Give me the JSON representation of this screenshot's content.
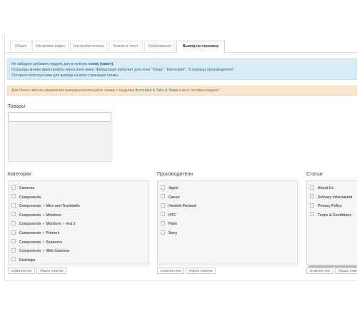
{
  "tabs": [
    {
      "label": "Общее"
    },
    {
      "label": "Настройки видео"
    },
    {
      "label": "Настройки показа"
    },
    {
      "label": "Кнопки и текст"
    },
    {
      "label": "Изображения"
    },
    {
      "label": "Вывод на странице"
    }
  ],
  "info_alert": {
    "line1_pre": "Не забудьте добавить модуль для в нужную ",
    "line1_bold": "схему (макет)",
    "line1_post": ".",
    "line2": "Страницы можно фильтровать через поля ниже. Фильтрация работает для схем \"Товар\", \"Категория\", \"Страница производителя\".",
    "line3": "Оставьте поля пустыми для вывода на всех страницах схемы."
  },
  "warning_alert": {
    "pre": "Для более гибкого управления выводом используйте связку с модулем ",
    "link": "Accordion & Tabs & Steps",
    "post": " и ф-ю \"вставка модуля\""
  },
  "products": {
    "title": "Товары",
    "value": ""
  },
  "categories": {
    "title": "Категории",
    "items": [
      [
        "Cameras"
      ],
      [
        "Components"
      ],
      [
        "Components",
        "Mice and Trackballs"
      ],
      [
        "Components",
        "Monitors"
      ],
      [
        "Components",
        "Monitors",
        "test 1"
      ],
      [
        "Components",
        "Printers"
      ],
      [
        "Components",
        "Scanners"
      ],
      [
        "Components",
        "Web Cameras"
      ],
      [
        "Desktops"
      ]
    ],
    "separator": ">"
  },
  "manufacturers": {
    "title": "Производители",
    "items": [
      "Apple",
      "Canon",
      "Hewlett-Packard",
      "HTC",
      "Palm",
      "Sony"
    ]
  },
  "articles": {
    "title": "Статьи",
    "items": [
      "About Us",
      "Delivery Information",
      "Privacy Policy",
      "Terms & Conditions"
    ]
  },
  "buttons": {
    "select_all": "Отметить все",
    "unselect": "Убрать отметки"
  }
}
